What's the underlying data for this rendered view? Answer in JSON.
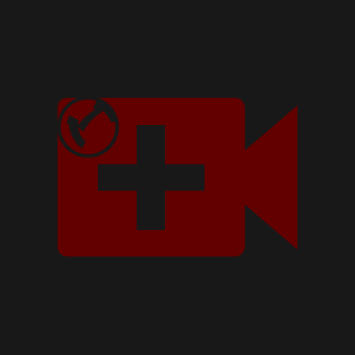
{
  "icon": {
    "name": "add-video-call-icon",
    "parts": [
      "video-camera-icon",
      "plus-icon",
      "phone-icon"
    ]
  },
  "colors": {
    "background": "#181818",
    "camera": "#620000",
    "cutout": "#181818"
  }
}
